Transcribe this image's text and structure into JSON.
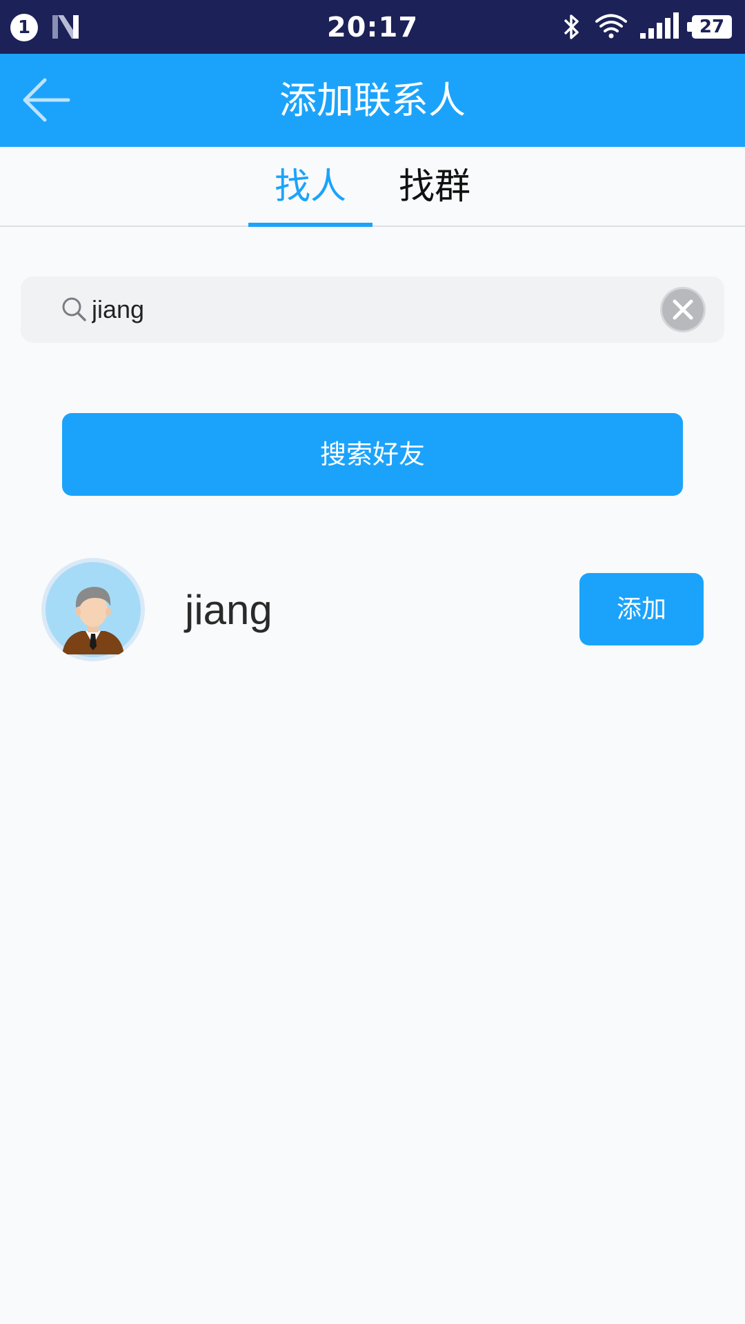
{
  "status_bar": {
    "notification_count": "1",
    "time": "20:17",
    "battery_level": "27"
  },
  "header": {
    "title": "添加联系人"
  },
  "tabs": [
    {
      "label": "找人",
      "active": true
    },
    {
      "label": "找群",
      "active": false
    }
  ],
  "search": {
    "value": "jiang"
  },
  "search_button": {
    "label": "搜索好友"
  },
  "results": [
    {
      "name": "jiang",
      "add_label": "添加"
    }
  ],
  "colors": {
    "status_bar": "#1c2158",
    "accent": "#1ba3fb",
    "background": "#f9fafb"
  },
  "icons": {
    "back": "arrow-left-icon",
    "search": "search-icon",
    "clear": "close-circle-icon",
    "bluetooth": "bluetooth-icon",
    "wifi": "wifi-icon",
    "signal": "signal-icon"
  }
}
